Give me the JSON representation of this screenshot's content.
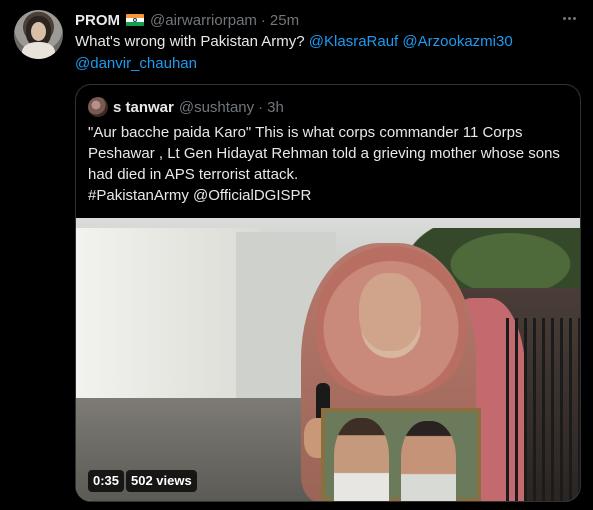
{
  "tweet": {
    "author_name": "PROM",
    "author_handle": "@airwarriorpam",
    "separator": "·",
    "time": "25m",
    "text_plain": "What's wrong with Pakistan Army? ",
    "mentions": [
      "@KlasraRauf",
      "@Arzookazmi30",
      "@danvir_chauhan"
    ],
    "flag_icon": "india-flag-icon",
    "more_icon": "more-icon"
  },
  "quote": {
    "author_name": "s tanwar",
    "author_handle": "@sushtany",
    "separator": "·",
    "time": "3h",
    "text_line1": "\"Aur bacche paida Karo\" This is what corps commander 11 Corps",
    "text_line2": "Peshawar , Lt Gen Hidayat Rehman told a grieving mother whose sons",
    "text_line3": "had died in APS terrorist attack.",
    "text_line4": "#PakistanArmy @OfficialDGISPR",
    "video": {
      "duration": "0:35",
      "views": "502 views"
    }
  },
  "colors": {
    "background": "#000000",
    "text": "#e7e9ea",
    "secondary": "#71767b",
    "link": "#1d9bf0",
    "border": "#2f3336"
  }
}
